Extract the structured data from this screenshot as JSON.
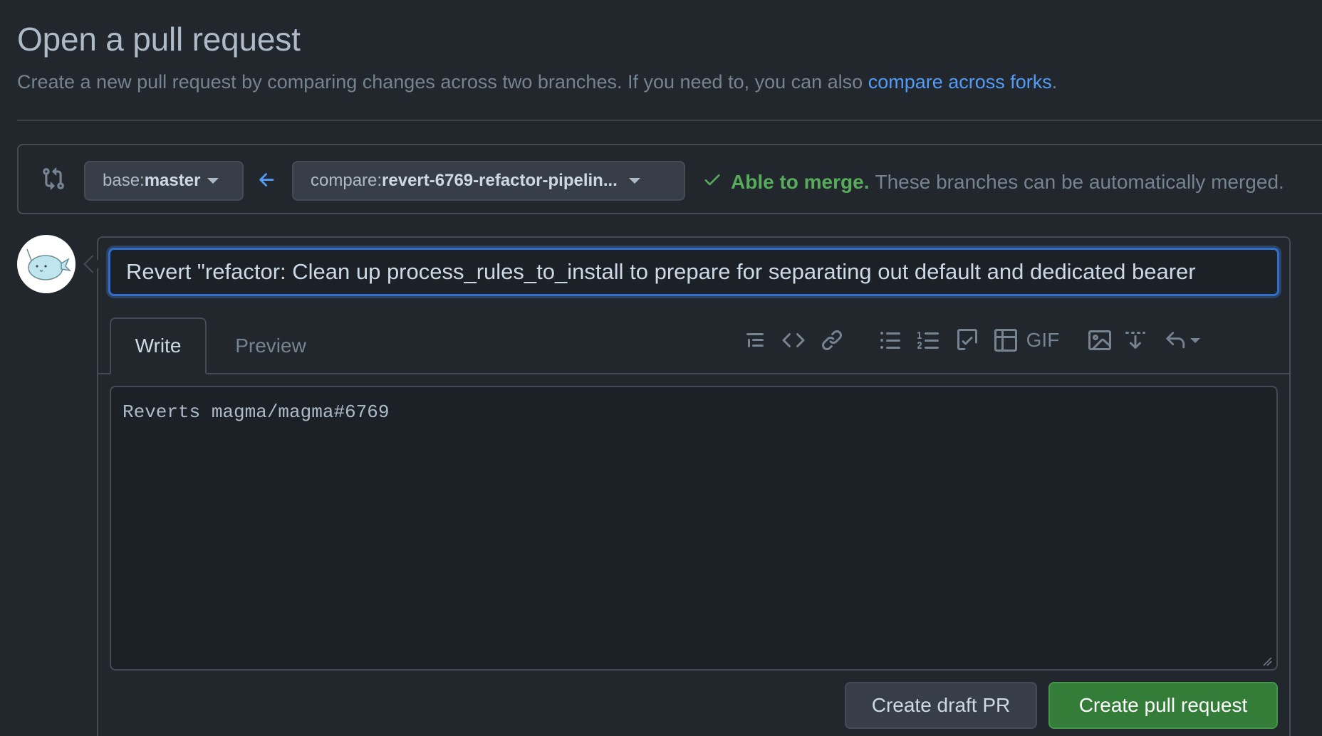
{
  "header": {
    "title": "Open a pull request",
    "subtitle_prefix": "Create a new pull request by comparing changes across two branches. If you need to, you can also ",
    "subtitle_link": "compare across forks",
    "subtitle_suffix": "."
  },
  "compare_bar": {
    "base_prefix": "base: ",
    "base_value": "master",
    "compare_prefix": "compare: ",
    "compare_value": "revert-6769-refactor-pipelin...",
    "merge_ok": "Able to merge.",
    "merge_message": "These branches can be automatically merged."
  },
  "composer": {
    "title_value": "Revert \"refactor: Clean up process_rules_to_install to prepare for separating out default and dedicated bearer",
    "tabs": [
      "Write",
      "Preview"
    ],
    "toolbar_gif": "GIF",
    "body_value": "Reverts magma/magma#6769"
  },
  "actions": {
    "draft_label": "Create draft PR",
    "create_label": "Create pull request"
  },
  "colors": {
    "background": "#22272e",
    "accent_link": "#539bf5",
    "success": "#57ab5a",
    "primary_button": "#347d39",
    "focus_border": "#316dca"
  }
}
